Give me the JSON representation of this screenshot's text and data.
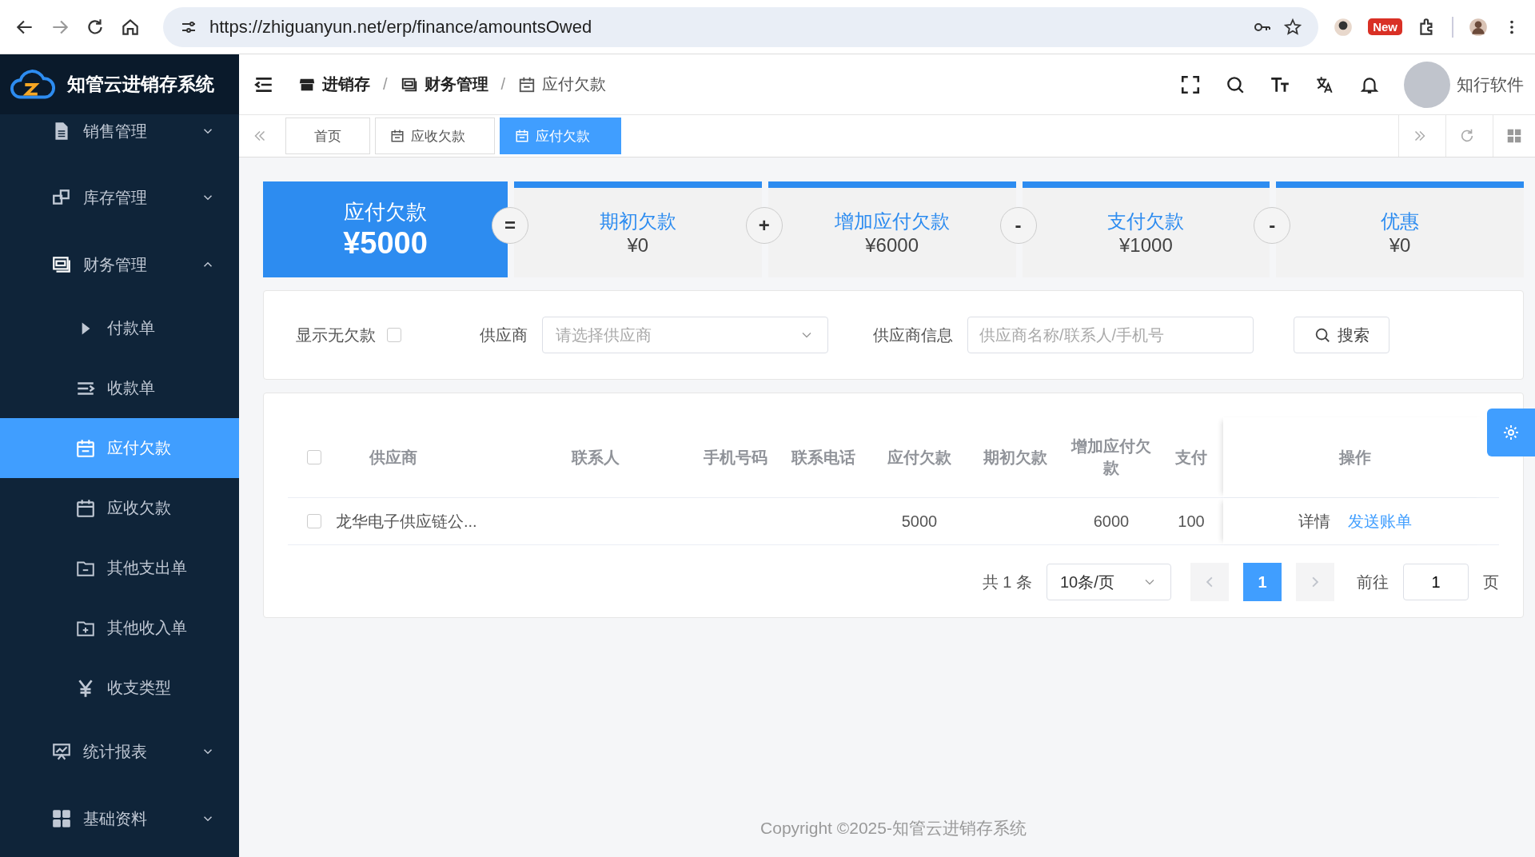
{
  "browser": {
    "url": "https://zhiguanyun.net/erp/finance/amountsOwed",
    "badge": "New"
  },
  "app": {
    "title": "知管云进销存系统",
    "breadcrumb": [
      "进销存",
      "财务管理",
      "应付欠款"
    ],
    "separator": "/",
    "user": "知行软件"
  },
  "sidebar": [
    {
      "label": "销售管理",
      "expanded": false,
      "selected": false
    },
    {
      "label": "库存管理",
      "expanded": false,
      "selected": false
    },
    {
      "label": "财务管理",
      "expanded": true,
      "selected": false,
      "children": [
        {
          "label": "付款单",
          "selected": false
        },
        {
          "label": "收款单",
          "selected": false
        },
        {
          "label": "应付欠款",
          "selected": true
        },
        {
          "label": "应收欠款",
          "selected": false
        },
        {
          "label": "其他支出单",
          "selected": false
        },
        {
          "label": "其他收入单",
          "selected": false
        },
        {
          "label": "收支类型",
          "selected": false
        }
      ]
    },
    {
      "label": "统计报表",
      "expanded": false,
      "selected": false
    },
    {
      "label": "基础资料",
      "expanded": false,
      "selected": false
    }
  ],
  "tabs": [
    {
      "label": "首页",
      "kind": "home",
      "selected": false
    },
    {
      "label": "应收欠款",
      "kind": "page",
      "selected": false
    },
    {
      "label": "应付欠款",
      "kind": "page",
      "selected": true
    }
  ],
  "summary": {
    "label": "应付欠款",
    "value": "¥5000",
    "items": [
      {
        "op": "=",
        "label": "期初欠款",
        "value": "¥0"
      },
      {
        "op": "+",
        "label": "增加应付欠款",
        "value": "¥6000"
      },
      {
        "op": "-",
        "label": "支付欠款",
        "value": "¥1000"
      },
      {
        "op": "-",
        "label": "优惠",
        "value": "¥0"
      }
    ]
  },
  "filter": {
    "show_label": "显示无欠款",
    "show_checked": false,
    "supplier_label": "供应商",
    "supplier_placeholder": "请选择供应商",
    "info_label": "供应商信息",
    "info_placeholder": "供应商名称/联系人/手机号",
    "search": "搜索"
  },
  "table": {
    "header_checked": false,
    "columns": [
      "供应商",
      "联系人",
      "手机号码",
      "联系电话",
      "应付欠款",
      "期初欠款",
      "增加应付欠款",
      "支付",
      "操作"
    ],
    "rows": [
      {
        "checked": false,
        "cells": [
          "龙华电子供应链公...",
          "",
          "",
          "",
          "5000",
          "",
          "6000",
          "100"
        ],
        "actions": [
          "详情",
          "发送账单"
        ]
      }
    ]
  },
  "pagination": {
    "total": "共 1 条",
    "size": "10条/页",
    "pages": [
      {
        "label": "1",
        "selected": true
      }
    ],
    "goto": "前往",
    "goto_value": "1",
    "suffix": "页"
  },
  "footer": "Copyright ©2025-知管云进销存系统"
}
